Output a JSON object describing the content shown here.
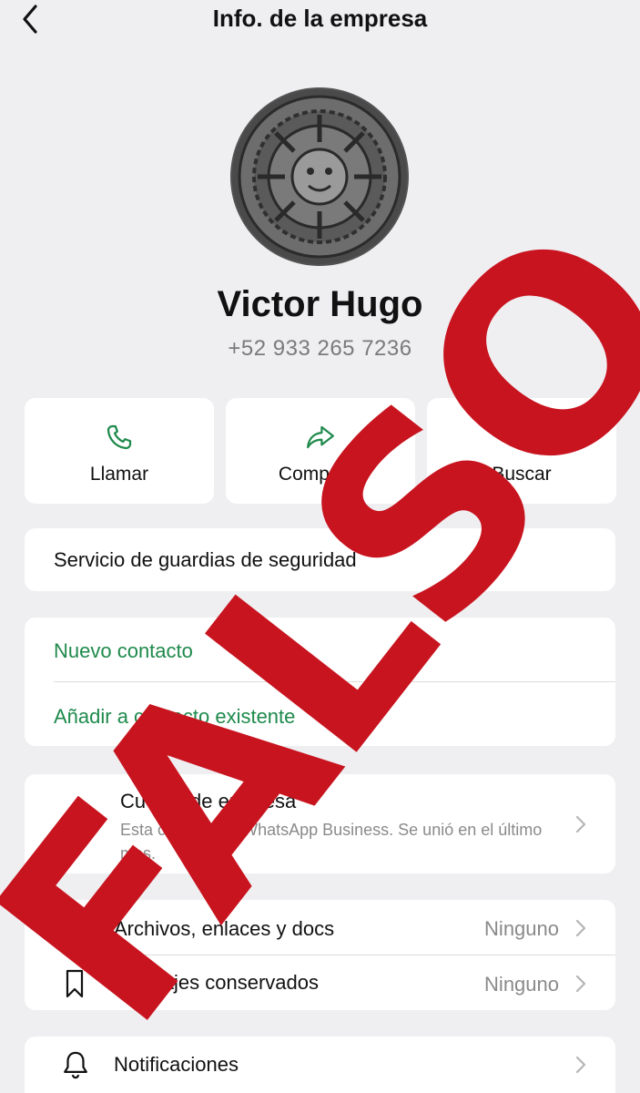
{
  "header": {
    "title": "Info. de la empresa"
  },
  "profile": {
    "name": "Victor Hugo",
    "phone": "+52 933 265 7236"
  },
  "actions": [
    {
      "label": "Llamar",
      "icon": "phone-icon"
    },
    {
      "label": "Compartir",
      "icon": "share-icon"
    },
    {
      "label": "Buscar",
      "icon": "search-icon"
    }
  ],
  "description": "Servicio de guardias de seguridad",
  "contact_options": {
    "new_contact": "Nuevo contacto",
    "add_existing": "Añadir a contacto existente"
  },
  "business_account": {
    "title": "Cuenta de empresa",
    "subtitle": "Esta cuenta usa WhatsApp Business. Se unió en el último mes."
  },
  "media": {
    "files_label": "Archivos, enlaces y docs",
    "files_value": "Ninguno",
    "starred_label": "Mensajes conservados",
    "starred_value": "Ninguno"
  },
  "notifications": {
    "label": "Notificaciones"
  },
  "stamp": {
    "text": "FALSO"
  },
  "colors": {
    "accent": "#1f8a4c",
    "stamp": "#c8141f",
    "background": "#efeff2"
  }
}
